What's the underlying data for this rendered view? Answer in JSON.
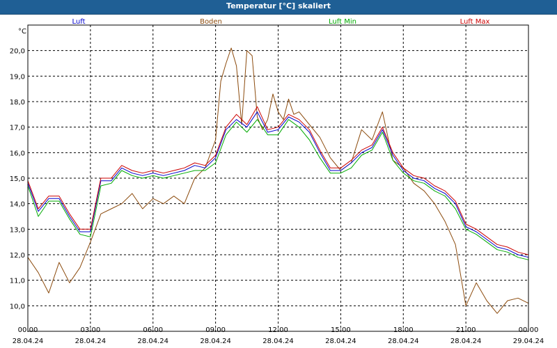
{
  "window": {
    "title": "Temperatur [°C] skaliert"
  },
  "chart_data": {
    "type": "line",
    "title": "Temperatur [°C] skaliert",
    "ylabel": "°C",
    "ylim": [
      9.0,
      21.0
    ],
    "y_ticks": [
      "10,0",
      "11,0",
      "12,0",
      "13,0",
      "14,0",
      "15,0",
      "16,0",
      "17,0",
      "18,0",
      "19,0",
      "20,0"
    ],
    "xlim": [
      "2024-04-28T00:00",
      "2024-04-29T00:00"
    ],
    "x_tick_times": [
      "00:00",
      "03:00",
      "06:00",
      "09:00",
      "12:00",
      "15:00",
      "18:00",
      "21:00",
      "00:00"
    ],
    "x_tick_dates": [
      "28.04.24",
      "28.04.24",
      "28.04.24",
      "28.04.24",
      "28.04.24",
      "28.04.24",
      "28.04.24",
      "28.04.24",
      "29.04.24"
    ],
    "grid": true,
    "legend_position": "top",
    "series": [
      {
        "name": "Luft",
        "color": "#0000cc",
        "x": [
          "00:00",
          "00:30",
          "01:00",
          "01:30",
          "02:00",
          "02:30",
          "03:00",
          "03:30",
          "04:00",
          "04:30",
          "05:00",
          "05:30",
          "06:00",
          "06:30",
          "07:00",
          "07:30",
          "08:00",
          "08:30",
          "09:00",
          "09:30",
          "10:00",
          "10:30",
          "11:00",
          "11:30",
          "12:00",
          "12:30",
          "13:00",
          "13:30",
          "14:00",
          "14:30",
          "15:00",
          "15:30",
          "16:00",
          "16:30",
          "17:00",
          "17:30",
          "18:00",
          "18:30",
          "19:00",
          "19:30",
          "20:00",
          "20:30",
          "21:00",
          "21:30",
          "22:00",
          "22:30",
          "23:00",
          "23:30",
          "24:00"
        ],
        "y": [
          14.8,
          13.7,
          14.2,
          14.2,
          13.5,
          12.9,
          12.9,
          14.9,
          14.9,
          15.4,
          15.2,
          15.1,
          15.2,
          15.1,
          15.2,
          15.3,
          15.5,
          15.4,
          15.8,
          16.9,
          17.3,
          17.0,
          17.6,
          16.8,
          16.9,
          17.4,
          17.2,
          16.8,
          16.0,
          15.3,
          15.3,
          15.6,
          16.0,
          16.2,
          16.9,
          15.9,
          15.3,
          15.0,
          14.9,
          14.6,
          14.4,
          14.0,
          13.1,
          12.9,
          12.6,
          12.3,
          12.2,
          12.0,
          11.9
        ]
      },
      {
        "name": "Boden",
        "color": "#8b4a0c",
        "x": [
          "00:00",
          "00:30",
          "01:00",
          "01:30",
          "02:00",
          "02:30",
          "03:00",
          "03:30",
          "04:00",
          "04:30",
          "05:00",
          "05:30",
          "06:00",
          "06:30",
          "07:00",
          "07:30",
          "08:00",
          "08:30",
          "09:00",
          "09:15",
          "09:30",
          "09:45",
          "10:00",
          "10:15",
          "10:30",
          "10:45",
          "11:00",
          "11:15",
          "11:30",
          "11:45",
          "12:00",
          "12:15",
          "12:30",
          "12:45",
          "13:00",
          "13:30",
          "14:00",
          "14:30",
          "15:00",
          "15:30",
          "16:00",
          "16:30",
          "17:00",
          "17:30",
          "18:00",
          "18:30",
          "19:00",
          "19:30",
          "20:00",
          "20:30",
          "21:00",
          "21:30",
          "22:00",
          "22:30",
          "23:00",
          "23:30",
          "24:00"
        ],
        "y": [
          11.9,
          11.3,
          10.5,
          11.7,
          10.9,
          11.5,
          12.5,
          13.6,
          13.8,
          14.0,
          14.4,
          13.8,
          14.2,
          14.0,
          14.3,
          14.0,
          15.0,
          15.4,
          16.5,
          18.8,
          19.5,
          20.1,
          19.4,
          17.1,
          20.0,
          19.8,
          17.4,
          16.9,
          17.3,
          18.3,
          17.6,
          17.3,
          18.1,
          17.5,
          17.6,
          17.1,
          16.6,
          15.8,
          15.3,
          15.6,
          16.9,
          16.5,
          17.6,
          15.7,
          15.4,
          14.8,
          14.5,
          14.0,
          13.3,
          12.4,
          10.0,
          10.9,
          10.2,
          9.7,
          10.2,
          10.3,
          10.1
        ]
      },
      {
        "name": "Luft Min",
        "color": "#00aa00",
        "x": [
          "00:00",
          "00:30",
          "01:00",
          "01:30",
          "02:00",
          "02:30",
          "03:00",
          "03:30",
          "04:00",
          "04:30",
          "05:00",
          "05:30",
          "06:00",
          "06:30",
          "07:00",
          "07:30",
          "08:00",
          "08:30",
          "09:00",
          "09:30",
          "10:00",
          "10:30",
          "11:00",
          "11:30",
          "12:00",
          "12:30",
          "13:00",
          "13:30",
          "14:00",
          "14:30",
          "15:00",
          "15:30",
          "16:00",
          "16:30",
          "17:00",
          "17:30",
          "18:00",
          "18:30",
          "19:00",
          "19:30",
          "20:00",
          "20:30",
          "21:00",
          "21:30",
          "22:00",
          "22:30",
          "23:00",
          "23:30",
          "24:00"
        ],
        "y": [
          14.7,
          13.5,
          14.1,
          14.1,
          13.4,
          12.8,
          12.7,
          14.7,
          14.8,
          15.3,
          15.1,
          15.0,
          15.1,
          15.0,
          15.1,
          15.2,
          15.3,
          15.3,
          15.6,
          16.7,
          17.2,
          16.8,
          17.3,
          16.7,
          16.7,
          17.3,
          17.0,
          16.5,
          15.8,
          15.2,
          15.2,
          15.4,
          15.9,
          16.1,
          16.8,
          15.7,
          15.2,
          14.9,
          14.8,
          14.5,
          14.3,
          13.8,
          13.0,
          12.8,
          12.5,
          12.2,
          12.1,
          11.9,
          11.8
        ]
      },
      {
        "name": "Luft Max",
        "color": "#cc0000",
        "x": [
          "00:00",
          "00:30",
          "01:00",
          "01:30",
          "02:00",
          "02:30",
          "03:00",
          "03:30",
          "04:00",
          "04:30",
          "05:00",
          "05:30",
          "06:00",
          "06:30",
          "07:00",
          "07:30",
          "08:00",
          "08:30",
          "09:00",
          "09:30",
          "10:00",
          "10:30",
          "11:00",
          "11:30",
          "12:00",
          "12:30",
          "13:00",
          "13:30",
          "14:00",
          "14:30",
          "15:00",
          "15:30",
          "16:00",
          "16:30",
          "17:00",
          "17:30",
          "18:00",
          "18:30",
          "19:00",
          "19:30",
          "20:00",
          "20:30",
          "21:00",
          "21:30",
          "22:00",
          "22:30",
          "23:00",
          "23:30",
          "24:00"
        ],
        "y": [
          14.9,
          13.8,
          14.3,
          14.3,
          13.6,
          13.0,
          13.0,
          15.0,
          15.0,
          15.5,
          15.3,
          15.2,
          15.3,
          15.2,
          15.3,
          15.4,
          15.6,
          15.5,
          15.9,
          17.0,
          17.5,
          17.1,
          17.8,
          16.9,
          17.0,
          17.5,
          17.3,
          16.9,
          16.1,
          15.4,
          15.4,
          15.7,
          16.1,
          16.3,
          17.0,
          16.0,
          15.4,
          15.1,
          15.0,
          14.7,
          14.5,
          14.1,
          13.2,
          13.0,
          12.7,
          12.4,
          12.3,
          12.1,
          12.0
        ]
      }
    ]
  }
}
